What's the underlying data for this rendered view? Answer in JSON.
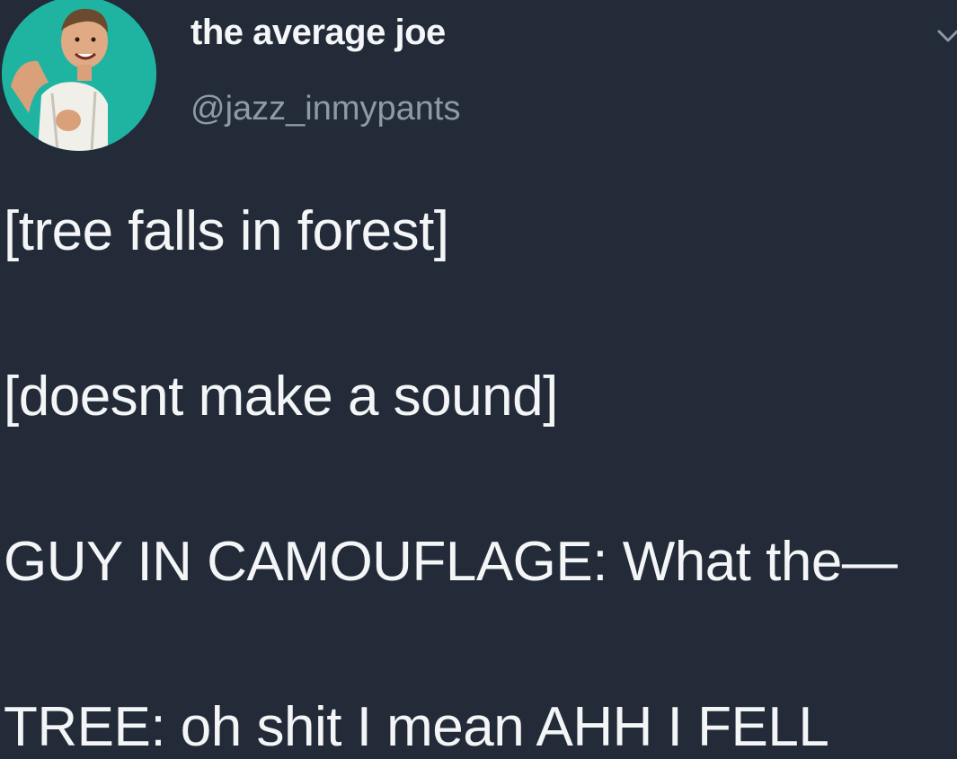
{
  "user": {
    "display_name": "the average joe",
    "handle": "@jazz_inmypants"
  },
  "icons": {
    "avatar": "profile-photo",
    "menu": "chevron-down-icon"
  },
  "colors": {
    "background": "#232b38",
    "text": "#f3f5f7",
    "handle": "#8d9aa7",
    "avatar_bg": "#1fb4a2"
  },
  "tweet": {
    "lines": [
      "[tree falls in forest]",
      "[doesnt make a sound]",
      "GUY IN CAMOUFLAGE: What the—",
      "TREE: oh shit I mean AHH I FELL"
    ]
  }
}
